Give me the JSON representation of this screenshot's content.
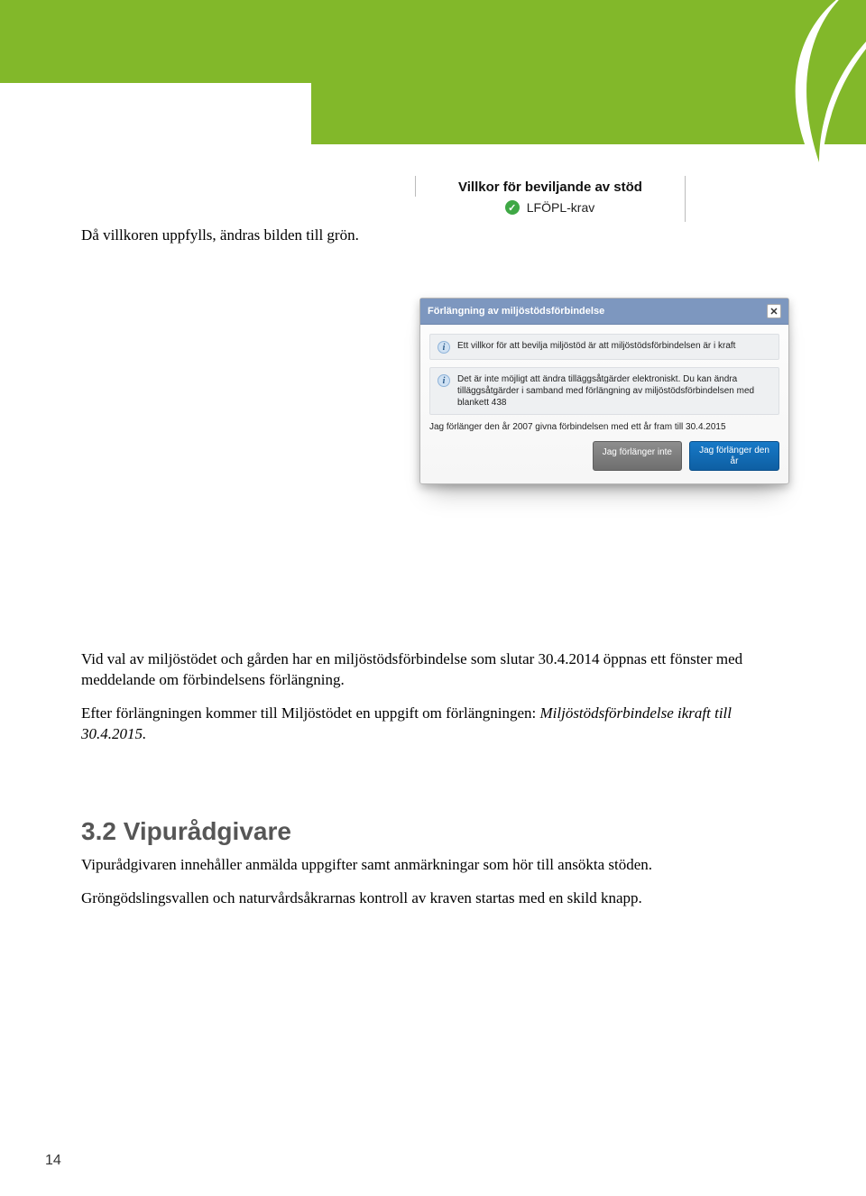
{
  "header": {},
  "intro": {
    "line": "Då villkoren uppfylls, ändras bilden till grön."
  },
  "villkor": {
    "title": "Villkor för beviljande av stöd",
    "item1": "LFÖPL-krav"
  },
  "dialog": {
    "title": "Förlängning av miljöstödsförbindelse",
    "info1": "Ett villkor för att bevilja miljöstöd är att miljöstödsförbindelsen är i kraft",
    "info2": "Det är inte möjligt att ändra tilläggsåtgärder elektroniskt. Du kan ändra tilläggsåtgärder i samband med förlängning av miljöstödsförbindelsen med blankett 438",
    "subtext": "Jag förlänger den år 2007 givna förbindelsen med ett år fram till 30.4.2015",
    "btn_no": "Jag förlänger inte",
    "btn_yes": "Jag förlänger den år"
  },
  "body": {
    "p1": "Vid val av miljöstödet och gården har en miljöstödsförbindelse som slutar 30.4.2014 öppnas ett fönster med meddelande om förbindelsens förlängning.",
    "p2a": "Efter förlängningen kommer till Miljöstödet en uppgift om förlängningen: ",
    "p2b": "Miljöstödsförbindelse ikraft till 30.4.2015.",
    "h2": "3.2 Vipurådgivare",
    "p3": "Vipurådgivaren innehåller anmälda uppgifter samt anmärkningar som hör till ansökta stöden.",
    "p4": "Gröngödslingsvallen och naturvårdsåkrarnas kontroll av kraven startas med en skild knapp."
  },
  "page": {
    "num": "14"
  }
}
